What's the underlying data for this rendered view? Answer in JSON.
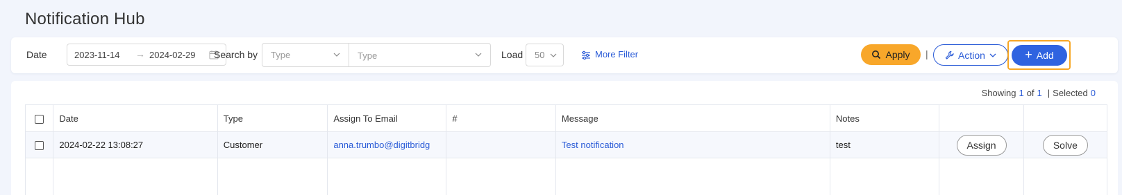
{
  "page": {
    "title": "Notification Hub"
  },
  "filters": {
    "date_label": "Date",
    "date_from": "2023-11-14",
    "date_to": "2024-02-29",
    "search_by_label": "Search by",
    "type_select_value": "Type",
    "type_select2_value": "Type",
    "load_label": "Load",
    "load_value": "50",
    "more_filter_label": "More Filter"
  },
  "toolbar": {
    "apply_label": "Apply",
    "separator": "|",
    "action_label": "Action",
    "add_label": "Add"
  },
  "status": {
    "showing_label": "Showing",
    "page_current": "1",
    "of_label": "of",
    "page_total": "1",
    "selected_label": "Selected",
    "selected_count": "0"
  },
  "table": {
    "headers": [
      "Date",
      "Type",
      "Assign To Email",
      "#",
      "Message",
      "Notes",
      "",
      ""
    ],
    "rows": [
      {
        "date": "2024-02-22 13:08:27",
        "type": "Customer",
        "email": "anna.trumbo@digitbridg",
        "number": "",
        "message": "Test notification",
        "notes": "test",
        "assign_label": "Assign",
        "solve_label": "Solve"
      }
    ]
  },
  "colors": {
    "accent": "#2f63e0",
    "apply": "#f8a72a",
    "highlight": "#f7a623",
    "background": "#f2f5fc"
  }
}
